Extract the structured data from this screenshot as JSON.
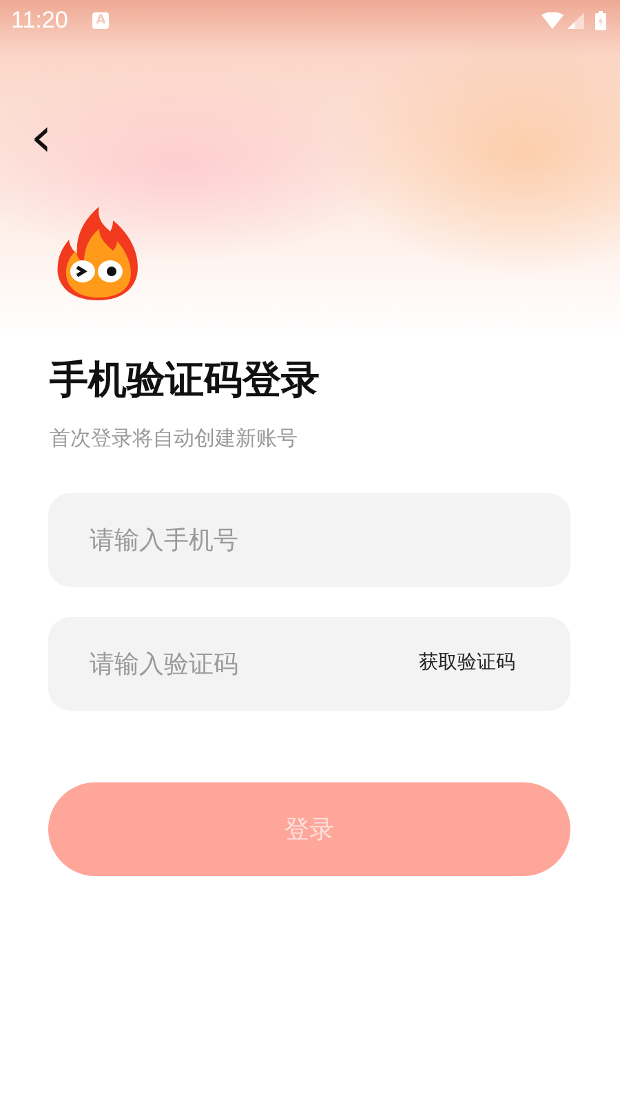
{
  "status_bar": {
    "time": "11:20",
    "notification": "A"
  },
  "header": {
    "back": "‹"
  },
  "title": "手机验证码登录",
  "subtitle": "首次登录将自动创建新账号",
  "phone_field": {
    "placeholder": "请输入手机号"
  },
  "code_field": {
    "placeholder": "请输入验证码",
    "action": "获取验证码"
  },
  "login_button": {
    "label": "登录",
    "disabled": true
  }
}
